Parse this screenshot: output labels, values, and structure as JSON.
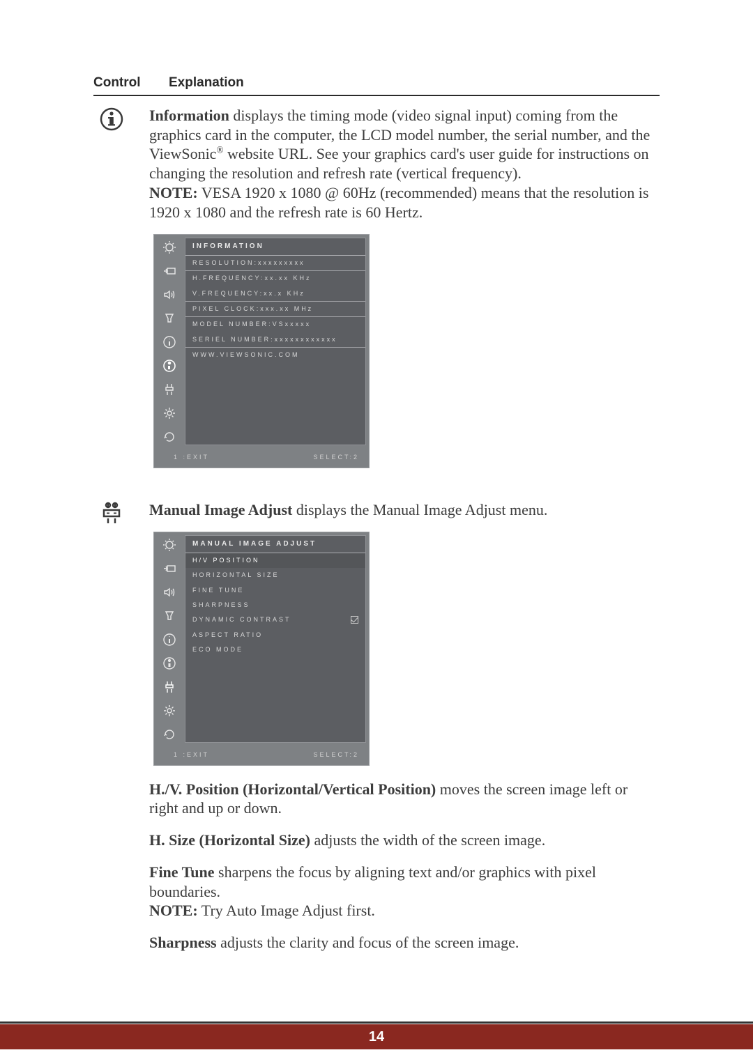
{
  "header": {
    "control": "Control",
    "explanation": "Explanation"
  },
  "information": {
    "title": "Information",
    "body_a": " displays the timing mode (video signal input) coming from the graphics card in the computer, the LCD model number, the serial number, and the ViewSonic",
    "body_b": " website URL. See your graphics card's user guide for instructions on changing the resolution and refresh rate (vertical frequency).",
    "note_label": "NOTE:",
    "note_body": " VESA 1920 x 1080 @ 60Hz (recommended) means that the resolution is 1920 x 1080 and the refresh rate is 60 Hertz.",
    "reg_mark": "®"
  },
  "osd_info": {
    "title": "INFORMATION",
    "resolution": "RESOLUTION:xxxxxxxxx",
    "h_freq": "H.FREQUENCY:xx.xx KHz",
    "v_freq": "V.FREQUENCY:xx.x  KHz",
    "pixel_clock": "PIXEL CLOCK:xxx.xx MHz",
    "model": "MODEL NUMBER:VSxxxxx",
    "serial": "SERIEL NUMBER:xxxxxxxxxxxx",
    "url": "WWW.VIEWSONIC.COM",
    "exit": "1 :EXIT",
    "select": "SELECT:2"
  },
  "manual_adjust": {
    "title_bold": "Manual Image Adjust",
    "title_rest": " displays the Manual Image Adjust menu."
  },
  "osd_mia": {
    "title": "MANUAL IMAGE ADJUST",
    "items": {
      "hv": "H/V POSITION",
      "hsize": "HORIZONTAL SIZE",
      "fine": "FINE TUNE",
      "sharp": "SHARPNESS",
      "dyn": "DYNAMIC CONTRAST",
      "aspect": "ASPECT RATIO",
      "eco": "ECO MODE"
    },
    "exit": "1 :EXIT",
    "select": "SELECT:2"
  },
  "hv_pos": {
    "bold": "H./V. Position (Horizontal/Vertical Position)",
    "rest": " moves the screen image left or right and up or down."
  },
  "hsize": {
    "bold": "H. Size (Horizontal Size)",
    "rest": " adjusts the width of the screen image."
  },
  "fine_tune": {
    "bold": "Fine Tune",
    "rest": " sharpens the focus by aligning text and/or graphics with pixel boundaries.",
    "note_label": "NOTE:",
    "note_rest": " Try Auto Image Adjust first."
  },
  "sharpness": {
    "bold": "Sharpness",
    "rest": " adjusts the clarity and focus of the screen image."
  },
  "page_number": "14"
}
